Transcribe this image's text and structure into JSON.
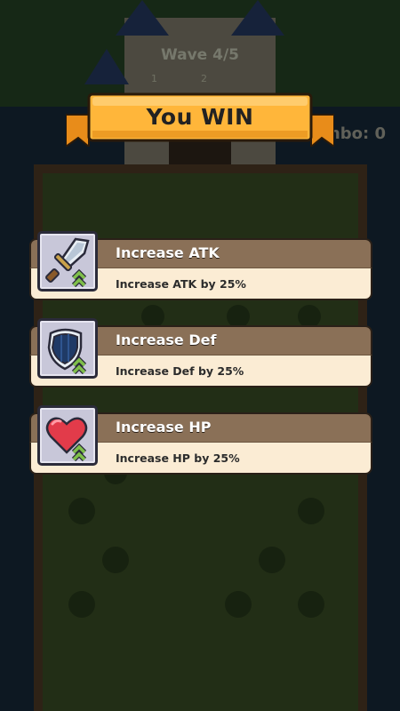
{
  "game": {
    "hud": {
      "wave_text": "Wave 4/5",
      "wave_stat_a": "1",
      "wave_stat_b": "2",
      "combo_text": "mbo: 0"
    },
    "banner": {
      "title": "You WIN"
    },
    "upgrades": [
      {
        "title": "Increase ATK",
        "description": "Increase ATK by 25%",
        "icon": "sword-icon"
      },
      {
        "title": "Increase Def",
        "description": "Increase Def by 25%",
        "icon": "shield-icon"
      },
      {
        "title": "Increase HP",
        "description": "Increase HP by 25%",
        "icon": "heart-icon"
      }
    ]
  },
  "colors": {
    "banner": "#ffb63a",
    "banner_ribbon": "#f09a1c",
    "card_header": "#8a7057",
    "card_body": "#fbecd4",
    "icon_bg": "#c8c7d9",
    "upgrade_arrow": "#7fbf4a"
  }
}
